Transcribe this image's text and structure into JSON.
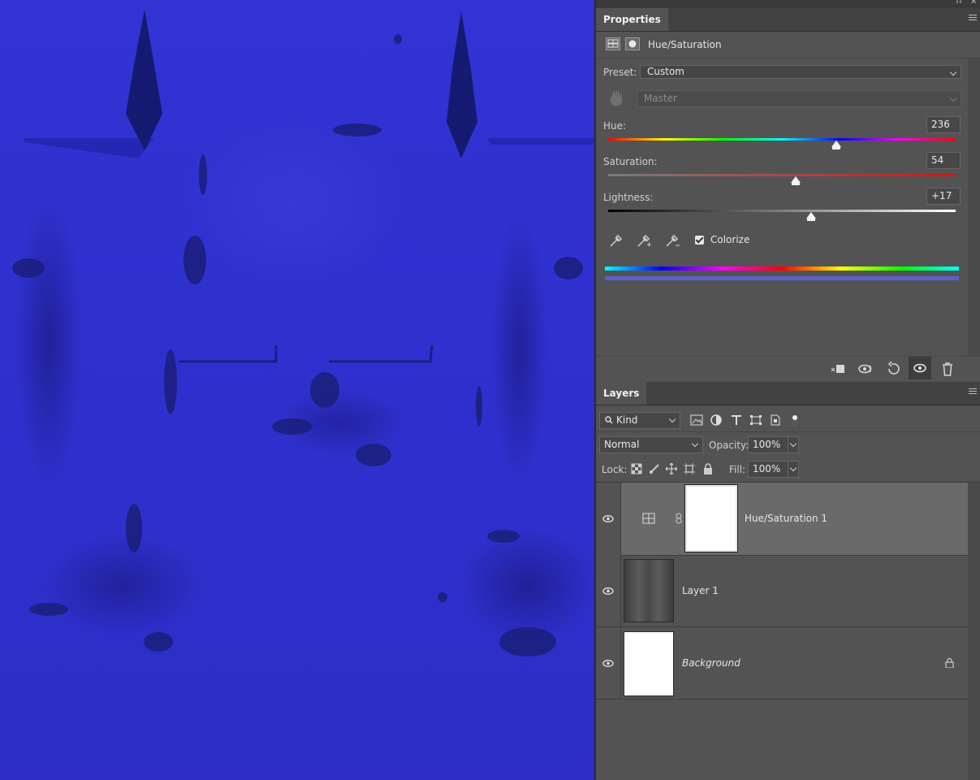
{
  "canvas": {
    "description_color": "#3133d2"
  },
  "window_controls": {
    "collapse": "‹‹",
    "close": "✕"
  },
  "properties": {
    "tab_label": "Properties",
    "adjustment_title": "Hue/Saturation",
    "preset_label": "Preset:",
    "preset_value": "Custom",
    "channel_value": "Master",
    "hue": {
      "label": "Hue:",
      "value": "236",
      "level": 236,
      "min": -180,
      "max": 180
    },
    "saturation": {
      "label": "Saturation:",
      "value": "54",
      "level": 54,
      "min": -100,
      "max": 100
    },
    "lightness": {
      "label": "Lightness:",
      "value": "+17",
      "level": 17,
      "min": -100,
      "max": 100
    },
    "colorize_label": "Colorize",
    "colorize_checked": true,
    "result_color": "#5a5fd0"
  },
  "layers": {
    "tab_label": "Layers",
    "filter_kind": "Kind",
    "blend_mode": "Normal",
    "opacity_label": "Opacity:",
    "opacity_value": "100%",
    "lock_label": "Lock:",
    "fill_label": "Fill:",
    "fill_value": "100%",
    "items": [
      {
        "name": "Hue/Saturation 1",
        "selected": true
      },
      {
        "name": "Layer 1",
        "selected": false
      },
      {
        "name": "Background",
        "selected": false,
        "locked": true
      }
    ]
  },
  "icons": {
    "eye": "eye-icon",
    "lock": "lock-icon",
    "link": "chain-link-icon",
    "trash": "trash-icon",
    "eyedropper": "eyedropper-icon"
  }
}
